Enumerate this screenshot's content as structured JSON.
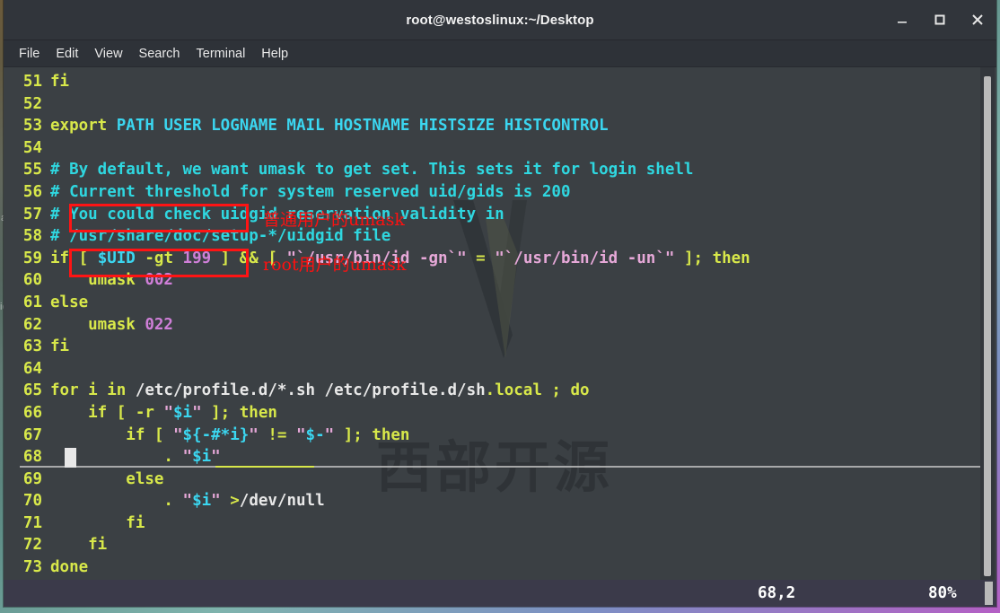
{
  "window": {
    "title": "root@westoslinux:~/Desktop",
    "buttons": {
      "minimize": "minimize-button",
      "maximize": "maximize-button",
      "close": "close-button"
    }
  },
  "menubar": {
    "items": [
      {
        "label": "File"
      },
      {
        "label": "Edit"
      },
      {
        "label": "View"
      },
      {
        "label": "Search"
      },
      {
        "label": "Terminal"
      },
      {
        "label": "Help"
      }
    ]
  },
  "editor": {
    "lines": [
      {
        "num": "51",
        "tokens": [
          {
            "t": "fi",
            "c": "c-kw"
          }
        ]
      },
      {
        "num": "52",
        "tokens": []
      },
      {
        "num": "53",
        "tokens": [
          {
            "t": "export ",
            "c": "c-kw"
          },
          {
            "t": "PATH USER LOGNAME MAIL HOSTNAME HISTSIZE HISTCONTROL",
            "c": "c-var"
          }
        ]
      },
      {
        "num": "54",
        "tokens": []
      },
      {
        "num": "55",
        "tokens": [
          {
            "t": "# By default, we want umask to get set. This sets it for login shell",
            "c": "c-cmt"
          }
        ]
      },
      {
        "num": "56",
        "tokens": [
          {
            "t": "# Current threshold for system reserved uid/gids is 200",
            "c": "c-cmt"
          }
        ]
      },
      {
        "num": "57",
        "tokens": [
          {
            "t": "# You could check uidgid reservation validity in",
            "c": "c-cmt"
          }
        ]
      },
      {
        "num": "58",
        "tokens": [
          {
            "t": "# /usr/share/doc/setup-*/uidgid file",
            "c": "c-cmt"
          }
        ]
      },
      {
        "num": "59",
        "tokens": [
          {
            "t": "if [ ",
            "c": "c-kw"
          },
          {
            "t": "$UID",
            "c": "c-var"
          },
          {
            "t": " -gt ",
            "c": "c-kw"
          },
          {
            "t": "199",
            "c": "c-num"
          },
          {
            "t": " ] && [ ",
            "c": "c-kw"
          },
          {
            "t": "\"`/usr/bin/id -gn`\"",
            "c": "c-str"
          },
          {
            "t": " = ",
            "c": "c-kw"
          },
          {
            "t": "\"`/usr/bin/id -un`\"",
            "c": "c-str"
          },
          {
            "t": " ]; then",
            "c": "c-kw"
          }
        ]
      },
      {
        "num": "60",
        "tokens": [
          {
            "t": "    umask ",
            "c": "c-kw"
          },
          {
            "t": "002",
            "c": "c-num"
          }
        ]
      },
      {
        "num": "61",
        "tokens": [
          {
            "t": "else",
            "c": "c-kw"
          }
        ]
      },
      {
        "num": "62",
        "tokens": [
          {
            "t": "    umask ",
            "c": "c-kw"
          },
          {
            "t": "022",
            "c": "c-num"
          }
        ]
      },
      {
        "num": "63",
        "tokens": [
          {
            "t": "fi",
            "c": "c-kw"
          }
        ]
      },
      {
        "num": "64",
        "tokens": []
      },
      {
        "num": "65",
        "tokens": [
          {
            "t": "for i in ",
            "c": "c-kw"
          },
          {
            "t": "/etc/profile.d/*.sh /etc/profile.d/sh",
            "c": "c-plain"
          },
          {
            "t": ".local ",
            "c": "c-kw"
          },
          {
            "t": "; do",
            "c": "c-kw"
          }
        ]
      },
      {
        "num": "66",
        "tokens": [
          {
            "t": "    if [ -r ",
            "c": "c-kw"
          },
          {
            "t": "\"",
            "c": "c-str"
          },
          {
            "t": "$i",
            "c": "c-var"
          },
          {
            "t": "\"",
            "c": "c-str"
          },
          {
            "t": " ]; then",
            "c": "c-kw"
          }
        ]
      },
      {
        "num": "67",
        "tokens": [
          {
            "t": "        if [ ",
            "c": "c-kw"
          },
          {
            "t": "\"",
            "c": "c-str"
          },
          {
            "t": "${-#*i}",
            "c": "c-var"
          },
          {
            "t": "\"",
            "c": "c-str"
          },
          {
            "t": " != ",
            "c": "c-kw"
          },
          {
            "t": "\"",
            "c": "c-str"
          },
          {
            "t": "$-",
            "c": "c-var"
          },
          {
            "t": "\"",
            "c": "c-str"
          },
          {
            "t": " ]; then",
            "c": "c-kw"
          }
        ]
      },
      {
        "num": "68",
        "tokens": [
          {
            "t": "            . ",
            "c": "c-kw"
          },
          {
            "t": "\"",
            "c": "c-str"
          },
          {
            "t": "$i",
            "c": "c-var"
          },
          {
            "t": "\"",
            "c": "c-str"
          }
        ],
        "cursorline": true
      },
      {
        "num": "69",
        "tokens": [
          {
            "t": "        else",
            "c": "c-kw"
          }
        ]
      },
      {
        "num": "70",
        "tokens": [
          {
            "t": "            . ",
            "c": "c-kw"
          },
          {
            "t": "\"",
            "c": "c-str"
          },
          {
            "t": "$i",
            "c": "c-var"
          },
          {
            "t": "\"",
            "c": "c-str"
          },
          {
            "t": " ",
            "c": "c-plain"
          },
          {
            "t": ">",
            "c": "c-op"
          },
          {
            "t": "/dev/null",
            "c": "c-plain"
          }
        ]
      },
      {
        "num": "71",
        "tokens": [
          {
            "t": "        fi",
            "c": "c-kw"
          }
        ]
      },
      {
        "num": "72",
        "tokens": [
          {
            "t": "    fi",
            "c": "c-kw"
          }
        ]
      },
      {
        "num": "73",
        "tokens": [
          {
            "t": "done",
            "c": "c-kw"
          }
        ]
      }
    ]
  },
  "annotations": [
    {
      "label": "普通用户的umask"
    },
    {
      "label": "root用户的umask"
    }
  ],
  "watermark": {
    "text": "西部开源"
  },
  "statusline": {
    "position": "68,2",
    "percent": "80%"
  },
  "desktop_ghost": [
    {
      "text": "ash"
    },
    {
      "text": "ioslir"
    }
  ],
  "colors": {
    "accent_yellow": "#d8e84a",
    "cyan": "#3bd6f0",
    "comment_cyan": "#2fd7e0",
    "string_pink": "#e6a8d8",
    "number_magenta": "#cf7fd8",
    "annotation_red": "#ff1010",
    "terminal_bg": "#3b4044",
    "titlebar_bg": "#31353b",
    "statusline_bg": "#3b3a4a"
  }
}
